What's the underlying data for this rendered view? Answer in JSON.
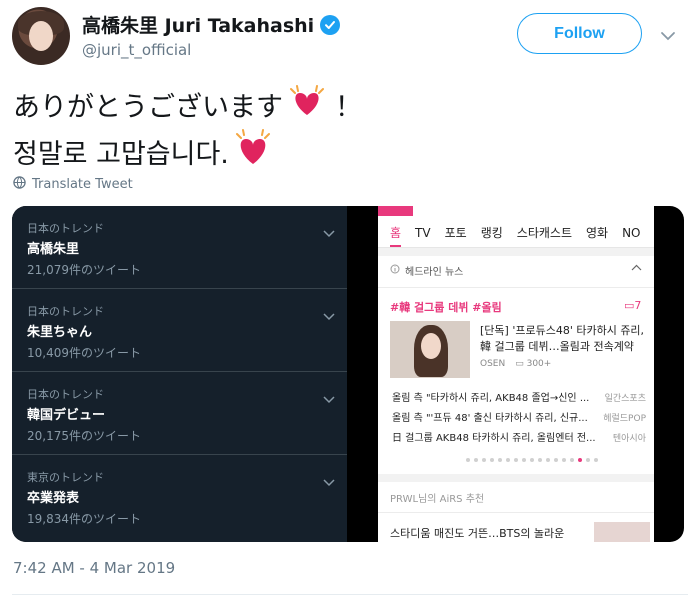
{
  "author": {
    "display_name": "高橋朱里 Juri Takahashi",
    "handle": "@juri_t_official",
    "verified": true,
    "follow_label": "Follow"
  },
  "tweet": {
    "line1": "ありがとうございます",
    "line1_suffix": "！",
    "line2": "정말로 고맙습니다.",
    "translate_label": "Translate Tweet",
    "timestamp": "7:42 AM - 4 Mar 2019"
  },
  "colors": {
    "accent": "#1da1f2",
    "trends_bg": "#15202b",
    "heart": "#e0245e",
    "phone_accent": "#e8397d"
  },
  "icons": [
    "verified-badge-icon",
    "chevron-down-icon",
    "globe-icon",
    "heart-emoji-icon"
  ],
  "trends": [
    {
      "category": "日本のトレンド",
      "title": "高橋朱里",
      "count": "21,079件のツイート"
    },
    {
      "category": "日本のトレンド",
      "title": "朱里ちゃん",
      "count": "10,409件のツイート"
    },
    {
      "category": "日本のトレンド",
      "title": "韓国デビュー",
      "count": "20,175件のツイート"
    },
    {
      "category": "東京のトレンド",
      "title": "卒業発表",
      "count": "19,834件のツイート"
    }
  ],
  "phone": {
    "tabs": [
      "홈",
      "TV",
      "포토",
      "랭킹",
      "스타캐스트",
      "영화",
      "NO"
    ],
    "headline_label": "헤드라인 뉴스",
    "topic": "#韓 걸그룹 데뷔 #올림",
    "comment_count": "7",
    "story": "[단독] '프로듀스48' 타카하시 쥬리, 韓 걸그룹 데뷔…올림과 전속계약",
    "story_source": "OSEN",
    "story_comments": "300+",
    "list": [
      {
        "text": "올림 측 \"타카하시 쥬리, AKB48 졸업→신인 ...",
        "source": "일간스포츠"
      },
      {
        "text": "올림 측 \"'프듀 48' 출신 타카하시 쥬리, 신규...",
        "source": "헤럴드POP"
      },
      {
        "text": "日 걸그룹 AKB48 타카하시 쥬리, 올림엔터 전...",
        "source": "텐아시아"
      }
    ],
    "airs_label": "PRWL님의 AiRS 추천",
    "bts_text": "스타디움 매진도 거뜬…BTS의 놀라운"
  }
}
